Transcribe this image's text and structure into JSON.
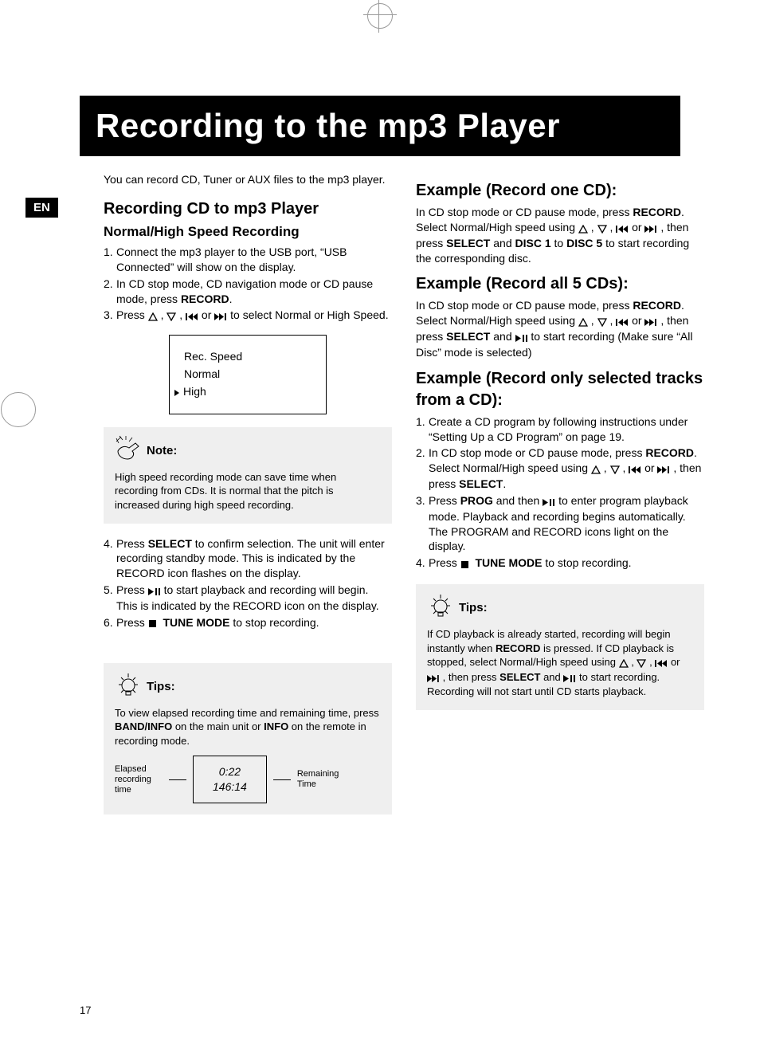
{
  "langBadge": "EN",
  "title": "Recording to the mp3 Player",
  "intro": "You can record CD, Tuner or AUX files to the mp3 player.",
  "left": {
    "h2": "Recording CD to mp3 Player",
    "h3": "Normal/High Speed Recording",
    "step1_num": "1.",
    "step1": "Connect the mp3 player to the USB port, “USB Connected” will show on the display.",
    "step2_num": "2.",
    "step2_a": "In CD stop mode, CD navigation mode or CD pause mode, press ",
    "step2_b": "RECORD",
    "step2_c": ".",
    "step3_num": "3.",
    "step3_a": "Press ",
    "step3_b": " to select Normal or High Speed.",
    "display_l1": "Rec. Speed",
    "display_l2": "Normal",
    "display_l3": "High",
    "note_head": "Note:",
    "note_body": "High speed recording mode can save time when recording from CDs. It is normal that the pitch is increased during high speed recording.",
    "step4_num": "4.",
    "step4_a": "Press ",
    "step4_b": "SELECT",
    "step4_c": " to confirm selection. The unit will enter recording standby mode. This is indicated by the RECORD icon flashes on the display.",
    "step5_num": "5.",
    "step5_a": "Press ",
    "step5_b": " to start playback and recording will begin. This is indicated by the RECORD icon on the display.",
    "step6_num": "6.",
    "step6_a": "Press ",
    "step6_b": "TUNE MODE",
    "step6_c": " to stop recording.",
    "tips_head": "Tips:",
    "tips_body_a": "To view elapsed recording time and remaining time, press ",
    "tips_body_b": "BAND/INFO",
    "tips_body_c": " on the main unit or ",
    "tips_body_d": "INFO",
    "tips_body_e": " on the remote in recording mode.",
    "elapsed_lbl": "Elapsed recording time",
    "elapsed_v1": "0:22",
    "elapsed_v2": "146:14",
    "remaining_lbl": "Remaining Time"
  },
  "right": {
    "ex1_h": "Example (Record one CD):",
    "ex1_a": "In CD stop mode or CD pause mode, press ",
    "ex1_b": "RECORD",
    "ex1_c": ". Select Normal/High speed using ",
    "ex1_d": " , then press ",
    "ex1_e": "SELECT",
    "ex1_f": " and ",
    "ex1_g": "DISC 1",
    "ex1_h2": " to ",
    "ex1_i": "DISC 5",
    "ex1_j": " to start recording the corresponding disc.",
    "ex2_h": "Example (Record all 5 CDs):",
    "ex2_a": "In CD stop mode or CD pause mode, press ",
    "ex2_b": "RECORD",
    "ex2_c": ". Select Normal/High speed using ",
    "ex2_d": " , then press ",
    "ex2_e": "SELECT",
    "ex2_f": " and ",
    "ex2_g": " to start recording  (Make sure “All Disc” mode is selected)",
    "ex3_h": "Example (Record only selected tracks from a CD):",
    "ex3_s1_num": "1.",
    "ex3_s1": "Create a CD program by following instructions under “Setting Up a CD Program” on page 19.",
    "ex3_s2_num": "2.",
    "ex3_s2_a": "In CD stop mode or CD pause mode, press ",
    "ex3_s2_b": "RECORD",
    "ex3_s2_c": ". Select Normal/High speed using ",
    "ex3_s2_d": " , then press ",
    "ex3_s2_e": "SELECT",
    "ex3_s2_f": ".",
    "ex3_s3_num": "3.",
    "ex3_s3_a": "Press ",
    "ex3_s3_b": "PROG",
    "ex3_s3_c": " and then ",
    "ex3_s3_d": " to enter program playback mode. Playback and recording begins automatically. The PROGRAM and RECORD icons light on the display.",
    "ex3_s4_num": "4.",
    "ex3_s4_a": "Press ",
    "ex3_s4_b": "TUNE MODE",
    "ex3_s4_c": " to stop recording.",
    "tips_head": "Tips:",
    "tips_a": "If CD playback is already started, recording will begin instantly when ",
    "tips_b": "RECORD",
    "tips_c": " is pressed. If CD playback is stopped, select Normal/High speed using ",
    "tips_d": " , then press ",
    "tips_e": "SELECT",
    "tips_f": " and ",
    "tips_g": " to start recording. Recording will not start until CD starts playback."
  },
  "pageNum": "17",
  "sep_comma": " , ",
  "sep_or": " or "
}
